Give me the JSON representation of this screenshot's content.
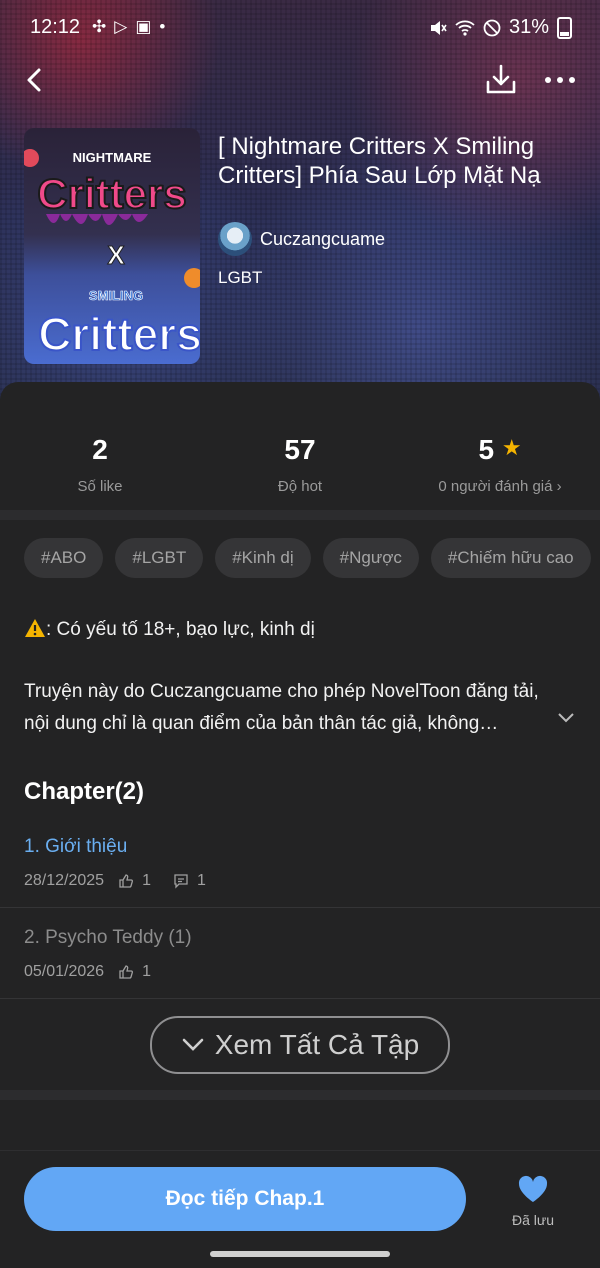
{
  "status_bar": {
    "time": "12:12",
    "battery": "31%"
  },
  "book": {
    "title": "[ Nightmare Critters X Smiling Critters] Phía Sau Lớp Mặt Nạ",
    "author": "Cuczangcuame",
    "genre": "LGBT",
    "cover": {
      "top_text": "NIGHTMARE",
      "top_word": "Critters",
      "x_text": "X",
      "bottom_text": "SMILING",
      "bottom_word": "Critters"
    }
  },
  "stats": [
    {
      "value": "2",
      "label": "Số like"
    },
    {
      "value": "57",
      "label": "Độ hot"
    },
    {
      "value": "5",
      "label": "0 người đánh giá"
    }
  ],
  "tags": [
    "#ABO",
    "#LGBT",
    "#Kinh dị",
    "#Ngược",
    "#Chiếm hữu cao"
  ],
  "warning": ": Có yếu tố 18+, bạo lực, kinh dị",
  "description": "Truyện này do Cuczangcuame cho phép NovelToon đăng tải, nội dung chỉ là quan điểm của bản thân tác giả, không…",
  "chapter_section": {
    "heading": "Chapter(2)",
    "chapters": [
      {
        "title": "1. Giới thiệu",
        "date": "28/12/2025",
        "likes": "1",
        "comments": "1"
      },
      {
        "title": "2. Psycho Teddy (1)",
        "date": "05/01/2026",
        "likes": "1"
      }
    ],
    "see_all": "Xem Tất Cả Tập"
  },
  "bottom": {
    "read_button": "Đọc tiếp Chap.1",
    "saved_label": "Đã lưu"
  },
  "colors": {
    "accent": "#62a7f5",
    "chapter_read": "#6aaef0",
    "star": "#f5b400"
  }
}
